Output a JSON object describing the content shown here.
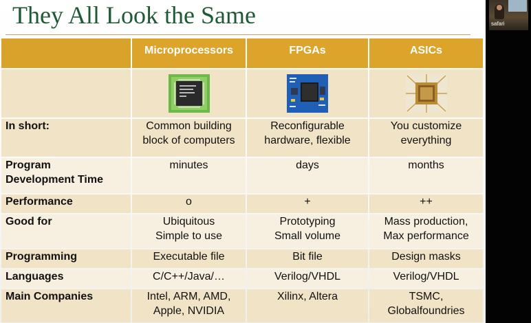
{
  "slide": {
    "title": "They All Look the Same",
    "columns": [
      "",
      "Microprocessors",
      "FPGAs",
      "ASICs"
    ],
    "image_row_icons": [
      "microprocessor-chip-icon",
      "fpga-board-icon",
      "asic-die-icon"
    ],
    "rows": [
      {
        "label": "In short:",
        "cells": [
          "Common building\nblock of computers",
          "Reconfigurable\nhardware, flexible",
          "You customize\neverything"
        ]
      },
      {
        "label": "Program\nDevelopment Time",
        "cells": [
          "minutes",
          "days",
          "months"
        ]
      },
      {
        "label": "Performance",
        "cells": [
          "o",
          "+",
          "++"
        ]
      },
      {
        "label": "Good for",
        "cells": [
          "Ubiquitous\nSimple to use",
          "Prototyping\nSmall volume",
          "Mass production,\nMax performance"
        ]
      },
      {
        "label": "Programming",
        "cells": [
          "Executable file",
          "Bit file",
          "Design masks"
        ]
      },
      {
        "label": "Languages",
        "cells": [
          "C/C++/Java/…",
          "Verilog/VHDL",
          "Verilog/VHDL"
        ]
      },
      {
        "label": "Main Companies",
        "cells": [
          "Intel, ARM, AMD,\nApple, NVIDIA",
          "Xilinx, Altera",
          "TSMC,\nGlobalfoundries"
        ]
      }
    ]
  },
  "video": {
    "label": "safari"
  },
  "colors": {
    "title": "#1e5a36",
    "header": "#dca42a",
    "row_dark": "#f1e3c6",
    "row_light": "#f7efdf"
  }
}
